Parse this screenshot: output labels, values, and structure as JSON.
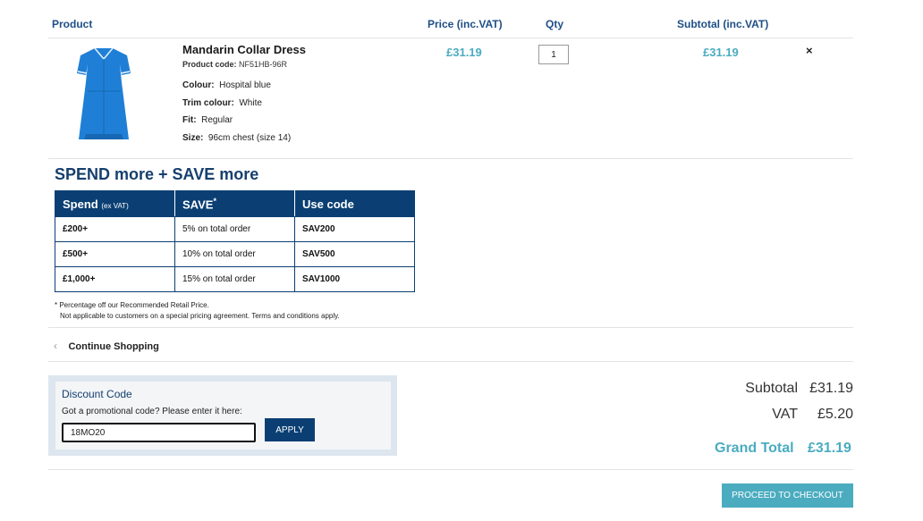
{
  "table_header": {
    "product": "Product",
    "price": "Price (inc.VAT)",
    "qty": "Qty",
    "subtotal": "Subtotal (inc.VAT)"
  },
  "item": {
    "name": "Mandarin Collar Dress",
    "code_label": "Product code:",
    "code": "NF51HB-96R",
    "attributes": [
      {
        "label": "Colour:",
        "value": "Hospital blue"
      },
      {
        "label": "Trim colour:",
        "value": "White"
      },
      {
        "label": "Fit:",
        "value": "Regular"
      },
      {
        "label": "Size:",
        "value": "96cm chest (size 14)"
      }
    ],
    "price": "£31.19",
    "qty": "1",
    "subtotal": "£31.19",
    "remove_icon": "×"
  },
  "spend_save": {
    "title": "SPEND more + SAVE more",
    "headers": {
      "spend": "Spend",
      "spend_sub": "(ex VAT)",
      "save": "SAVE",
      "save_sup": "*",
      "code": "Use code"
    },
    "rows": [
      {
        "spend": "£200+",
        "save": "5% on total order",
        "code": "SAV200"
      },
      {
        "spend": "£500+",
        "save": "10% on total order",
        "code": "SAV500"
      },
      {
        "spend": "£1,000+",
        "save": "15% on total order",
        "code": "SAV1000"
      }
    ],
    "note_line1": "* Percentage off our Recommended Retail Price.",
    "note_line2": "Not applicable to customers on a special pricing agreement. Terms and conditions apply."
  },
  "continue_shopping": {
    "icon": "chevron-left-icon",
    "label": "Continue Shopping"
  },
  "discount": {
    "title": "Discount Code",
    "hint": "Got a promotional code? Please enter it here:",
    "value": "18MO20",
    "apply_label": "APPLY"
  },
  "totals": {
    "subtotal_label": "Subtotal",
    "subtotal_value": "£31.19",
    "vat_label": "VAT",
    "vat_value": "£5.20",
    "grand_label": "Grand Total",
    "grand_value": "£31.19"
  },
  "checkout_label": "PROCEED TO CHECKOUT",
  "colors": {
    "brand_navy": "#0b3f73",
    "accent_teal": "#4bacc0",
    "dress_blue": "#1f7fd6"
  }
}
